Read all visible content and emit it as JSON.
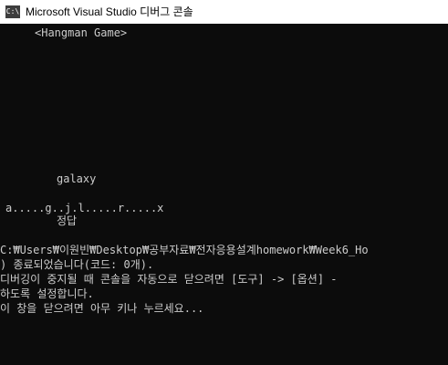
{
  "window": {
    "title": "Microsoft Visual Studio 디버그 콘솔",
    "icon_text": "C:\\"
  },
  "console": {
    "game_title": "<Hangman Game>",
    "answer_word": "galaxy",
    "guessed_letters": "a.....g..j.l.....r.....x",
    "answer_label": "정답",
    "exit_path": "C:₩Users₩이원빈₩Desktop₩공부자료₩전자응용설계homework₩Week6_Ho",
    "exit_code_message": ") 종료되었습니다(코드: 0개).",
    "auto_close_hint_1": "디버깅이 중지될 때 콘솔을 자동으로 닫으려면 [도구] -> [옵션] -",
    "auto_close_hint_2": "하도록 설정합니다.",
    "press_any_key": "이 창을 닫으려면 아무 키나 누르세요..."
  }
}
